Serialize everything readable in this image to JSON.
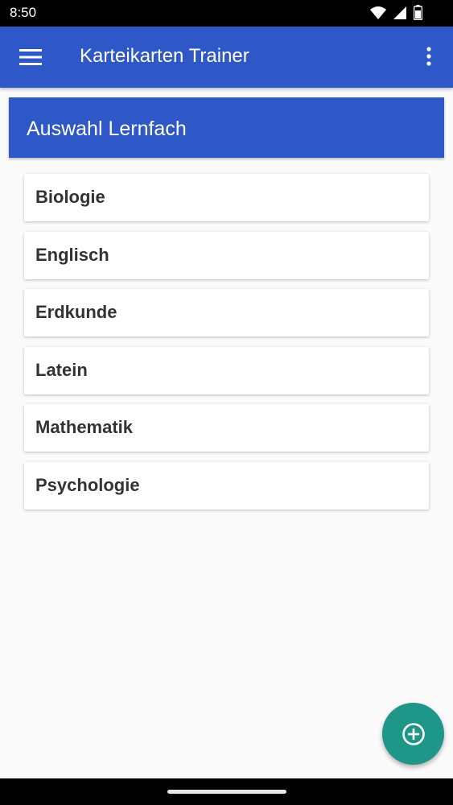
{
  "status_bar": {
    "time": "8:50",
    "icons": [
      "wifi-icon",
      "signal-icon",
      "battery-icon"
    ]
  },
  "app_bar": {
    "title": "Karteikarten Trainer",
    "menu_icon": "hamburger-menu-icon",
    "overflow_icon": "more-vert-icon",
    "color": "#2e57c7"
  },
  "section": {
    "title": "Auswahl Lernfach"
  },
  "subjects": [
    {
      "label": "Biologie"
    },
    {
      "label": "Englisch"
    },
    {
      "label": "Erdkunde"
    },
    {
      "label": "Latein"
    },
    {
      "label": "Mathematik"
    },
    {
      "label": "Psychologie"
    }
  ],
  "fab": {
    "icon": "add-circle-icon",
    "color": "#1e9688"
  }
}
